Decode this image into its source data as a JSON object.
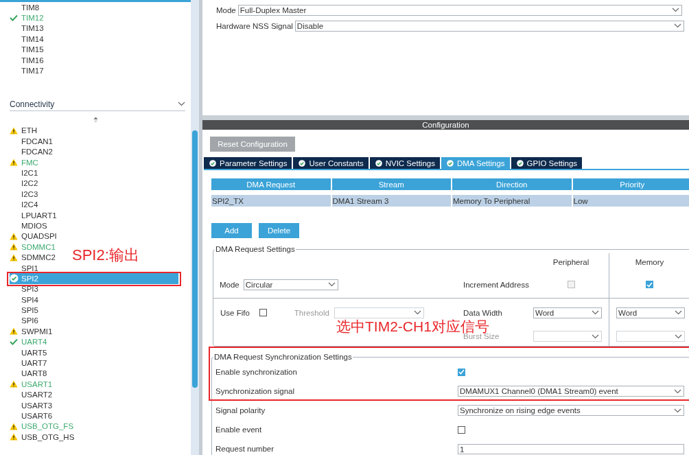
{
  "sidebar": {
    "timer_items": [
      {
        "label": "TIM8",
        "kind": "plain",
        "configured": false,
        "selected": false
      },
      {
        "label": "TIM12",
        "kind": "ok",
        "configured": true,
        "selected": false
      },
      {
        "label": "TIM13",
        "kind": "plain",
        "configured": false,
        "selected": false
      },
      {
        "label": "TIM14",
        "kind": "plain",
        "configured": false,
        "selected": false
      },
      {
        "label": "TIM15",
        "kind": "plain",
        "configured": false,
        "selected": false
      },
      {
        "label": "TIM16",
        "kind": "plain",
        "configured": false,
        "selected": false
      },
      {
        "label": "TIM17",
        "kind": "plain",
        "configured": false,
        "selected": false
      }
    ],
    "category": "Connectivity",
    "connectivity_items": [
      {
        "label": "ETH",
        "kind": "warning",
        "configured": false,
        "selected": false
      },
      {
        "label": "FDCAN1",
        "kind": "plain",
        "configured": false,
        "selected": false
      },
      {
        "label": "FDCAN2",
        "kind": "plain",
        "configured": false,
        "selected": false
      },
      {
        "label": "FMC",
        "kind": "warning",
        "configured": true,
        "selected": false
      },
      {
        "label": "I2C1",
        "kind": "plain",
        "configured": false,
        "selected": false
      },
      {
        "label": "I2C2",
        "kind": "plain",
        "configured": false,
        "selected": false
      },
      {
        "label": "I2C3",
        "kind": "plain",
        "configured": false,
        "selected": false
      },
      {
        "label": "I2C4",
        "kind": "plain",
        "configured": false,
        "selected": false
      },
      {
        "label": "LPUART1",
        "kind": "plain",
        "configured": false,
        "selected": false
      },
      {
        "label": "MDIOS",
        "kind": "plain",
        "configured": false,
        "selected": false
      },
      {
        "label": "QUADSPI",
        "kind": "warning",
        "configured": false,
        "selected": false
      },
      {
        "label": "SDMMC1",
        "kind": "warning",
        "configured": true,
        "selected": false
      },
      {
        "label": "SDMMC2",
        "kind": "warning",
        "configured": false,
        "selected": false
      },
      {
        "label": "SPI1",
        "kind": "plain",
        "configured": false,
        "selected": false
      },
      {
        "label": "SPI2",
        "kind": "ok",
        "configured": true,
        "selected": true
      },
      {
        "label": "SPI3",
        "kind": "plain",
        "configured": false,
        "selected": false
      },
      {
        "label": "SPI4",
        "kind": "plain",
        "configured": false,
        "selected": false
      },
      {
        "label": "SPI5",
        "kind": "plain",
        "configured": false,
        "selected": false
      },
      {
        "label": "SPI6",
        "kind": "plain",
        "configured": false,
        "selected": false
      },
      {
        "label": "SWPMI1",
        "kind": "warning",
        "configured": false,
        "selected": false
      },
      {
        "label": "UART4",
        "kind": "ok",
        "configured": true,
        "selected": false
      },
      {
        "label": "UART5",
        "kind": "plain",
        "configured": false,
        "selected": false
      },
      {
        "label": "UART7",
        "kind": "plain",
        "configured": false,
        "selected": false
      },
      {
        "label": "UART8",
        "kind": "plain",
        "configured": false,
        "selected": false
      },
      {
        "label": "USART1",
        "kind": "warning",
        "configured": true,
        "selected": false
      },
      {
        "label": "USART2",
        "kind": "plain",
        "configured": false,
        "selected": false
      },
      {
        "label": "USART3",
        "kind": "plain",
        "configured": false,
        "selected": false
      },
      {
        "label": "USART6",
        "kind": "plain",
        "configured": false,
        "selected": false
      },
      {
        "label": "USB_OTG_FS",
        "kind": "warning",
        "configured": true,
        "selected": false
      },
      {
        "label": "USB_OTG_HS",
        "kind": "warning",
        "configured": false,
        "selected": false
      }
    ]
  },
  "mode_settings": [
    {
      "label": "Mode",
      "value": "Full-Duplex Master"
    },
    {
      "label": "Hardware NSS Signal",
      "value": "Disable"
    }
  ],
  "configuration": {
    "title": "Configuration",
    "reset_button": "Reset Configuration",
    "tabs": [
      {
        "label": "Parameter Settings",
        "selected": false
      },
      {
        "label": "User Constants",
        "selected": false
      },
      {
        "label": "NVIC Settings",
        "selected": false
      },
      {
        "label": "DMA Settings",
        "selected": true
      },
      {
        "label": "GPIO Settings",
        "selected": false
      }
    ],
    "dma_table": {
      "columns": [
        "DMA Request",
        "Stream",
        "Direction",
        "Priority"
      ],
      "rows": [
        [
          "SPI2_TX",
          "DMA1 Stream 3",
          "Memory To Peripheral",
          "Low"
        ]
      ]
    },
    "buttons": [
      "Add",
      "Delete"
    ],
    "request_settings": {
      "title": "DMA Request Settings",
      "peripheral_header": "Peripheral",
      "memory_header": "Memory",
      "mode_label": "Mode",
      "mode_value": "Circular",
      "increment_label": "Increment Address",
      "peripheral_increment": false,
      "memory_increment": true,
      "use_fifo_label": "Use Fifo",
      "use_fifo": false,
      "threshold_label": "Threshold",
      "data_width_label": "Data Width",
      "peripheral_data_width": "Word",
      "memory_data_width": "Word",
      "burst_size_label": "Burst Size"
    },
    "sync_settings": {
      "title": "DMA Request Synchronization Settings",
      "rows": [
        {
          "kind": "checkbox",
          "label": "Enable synchronization",
          "checked": true
        },
        {
          "kind": "select",
          "label": "Synchronization signal",
          "value": "DMAMUX1 Channel0 (DMA1 Stream0) event"
        },
        {
          "kind": "select",
          "label": "Signal polarity",
          "value": "Synchronize on rising edge events"
        },
        {
          "kind": "checkbox",
          "label": "Enable event",
          "checked": false
        },
        {
          "kind": "input",
          "label": "Request number",
          "value": "1"
        }
      ]
    }
  },
  "annotations": [
    {
      "text": "SPI2:输出"
    },
    {
      "text": "选中TIM2-CH1对应信号"
    }
  ]
}
